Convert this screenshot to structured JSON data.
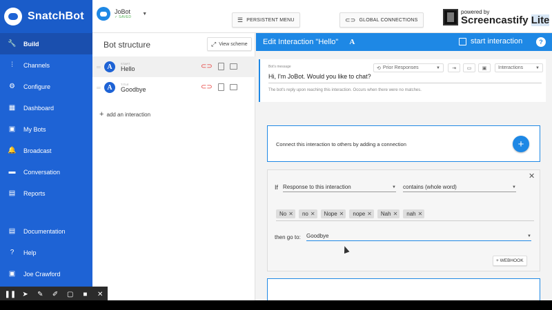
{
  "brand": {
    "name": "SnatchBot"
  },
  "sidebar": {
    "items": [
      {
        "label": "Build",
        "icon": "wrench-icon",
        "glyph": "🔧"
      },
      {
        "label": "Channels",
        "icon": "sliders-icon",
        "glyph": "⫶"
      },
      {
        "label": "Configure",
        "icon": "gear-icon",
        "glyph": "⚙"
      },
      {
        "label": "Dashboard",
        "icon": "dashboard-icon",
        "glyph": "▦"
      },
      {
        "label": "My Bots",
        "icon": "bots-icon",
        "glyph": "▣"
      },
      {
        "label": "Broadcast",
        "icon": "bell-icon",
        "glyph": "🔔"
      },
      {
        "label": "Conversation",
        "icon": "chat-icon",
        "glyph": "▬"
      },
      {
        "label": "Reports",
        "icon": "reports-icon",
        "glyph": "▤"
      }
    ],
    "bottom_items": [
      {
        "label": "Documentation",
        "icon": "document-icon",
        "glyph": "▤"
      },
      {
        "label": "Help",
        "icon": "help-icon",
        "glyph": "?"
      },
      {
        "label": "Joe Crawford",
        "icon": "user-icon",
        "glyph": "▣"
      }
    ]
  },
  "topbar": {
    "bot_name": "JoBot",
    "bot_status": "✓ SAVED",
    "persistent_menu": "PERSISTENT MENU",
    "global_connections": "GLOBAL CONNECTIONS"
  },
  "watermark": {
    "small": "powered by",
    "big": "Screencastify",
    "lite": "Lite"
  },
  "structure": {
    "title": "Bot structure",
    "view_scheme": "View scheme",
    "interactions": [
      {
        "type": "START",
        "name": "Hello"
      },
      {
        "type": "TITLE",
        "name": "Goodbye"
      }
    ],
    "add_interaction": "add an interaction"
  },
  "editor": {
    "title": "Edit Interaction \"Hello\"",
    "a_badge": "A",
    "start_interaction": "start interaction",
    "help": "?",
    "message_label": "Bot's message",
    "message_text": "Hi, I'm JoBot. Would you like to chat?",
    "message_help": "The bot's reply upon reaching this interaction. Occurs when there were no matches.",
    "prior_responses": "Prior Responses",
    "interactions_dropdown": "Interactions",
    "connect_text": "Connect this interaction to others by adding a connection",
    "condition": {
      "if_label": "If",
      "response_select": "Response to this interaction",
      "match_select": "contains (whole word)",
      "keywords": [
        "No",
        "no",
        "Nope",
        "nope",
        "Nah",
        "nah"
      ],
      "then_label": "then go to:",
      "goto_value": "Goodbye",
      "webhook": "+ WEBHOOK"
    }
  },
  "colors": {
    "sidebar": "#1e63d5",
    "accent": "#1e88e5",
    "link": "#e53935"
  }
}
